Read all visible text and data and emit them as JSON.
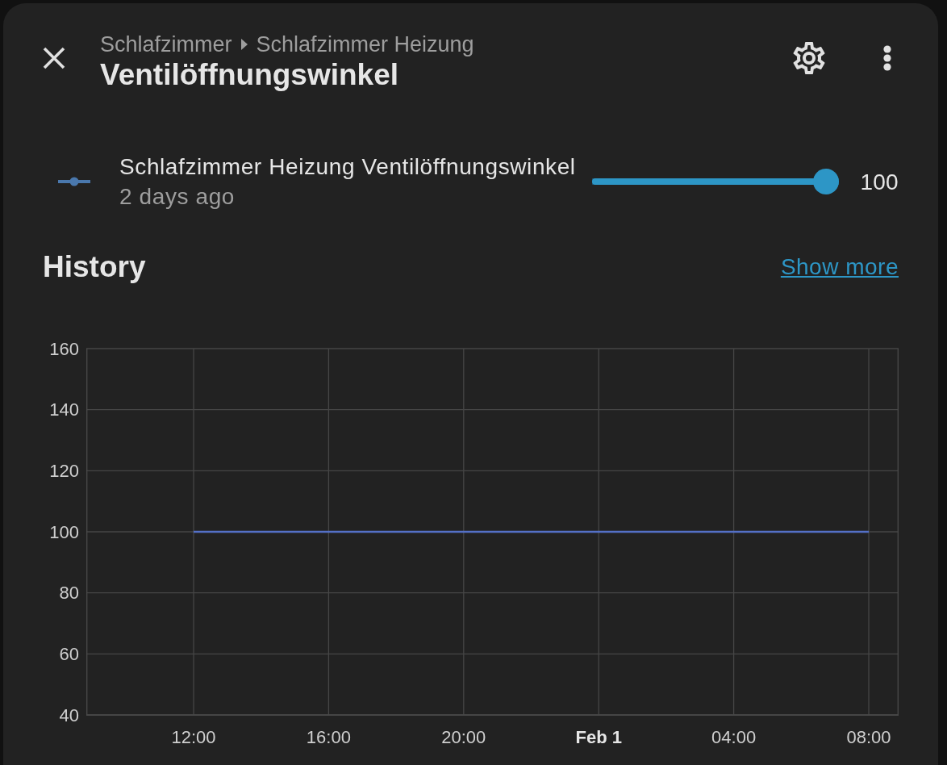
{
  "dialog": {
    "breadcrumb": [
      "Schlafzimmer",
      "Schlafzimmer Heizung"
    ],
    "title": "Ventilöffnungswinkel"
  },
  "entity": {
    "name": "Schlafzimmer Heizung Ventilöffnungswinkel",
    "last_changed": "2 days ago",
    "slider": {
      "level": 1
    },
    "reading": "100"
  },
  "history": {
    "title": "History",
    "link": "Show more",
    "chart_data": {
      "type": "line",
      "categories": [
        "12:00",
        "16:00",
        "20:00",
        "Feb 1",
        "04:00",
        "08:00"
      ],
      "series": [
        {
          "color": "#5470c6",
          "values": [
            100,
            100,
            100,
            100,
            100,
            100
          ]
        }
      ],
      "ylim": [
        40,
        160
      ],
      "yticks": [
        40,
        60,
        80,
        100,
        120,
        140,
        160
      ],
      "grid": true
    }
  }
}
